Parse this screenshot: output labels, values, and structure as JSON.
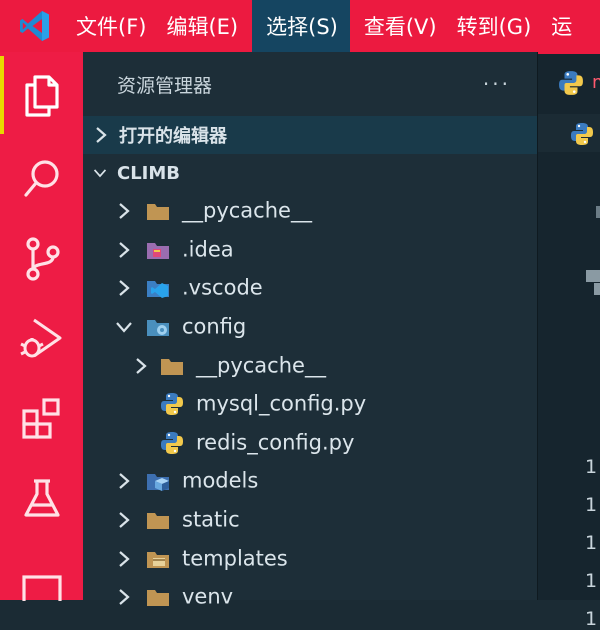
{
  "menu": {
    "items": [
      "文件(F)",
      "编辑(E)",
      "选择(S)",
      "查看(V)",
      "转到(G)",
      "运"
    ],
    "active_index": 2
  },
  "activity_bar": {
    "items": [
      "explorer-icon",
      "search-icon",
      "source-control-icon",
      "run-debug-icon",
      "extensions-icon",
      "testing-icon",
      "remote-icon"
    ],
    "active": "explorer-icon"
  },
  "explorer": {
    "title": "资源管理器",
    "more": "···",
    "open_editors_label": "打开的编辑器",
    "project_label": "CLIMB",
    "tree": [
      {
        "label": "__pycache__",
        "icon": "folder-icon",
        "expanded": false
      },
      {
        "label": ".idea",
        "icon": "idea-folder-icon",
        "expanded": false
      },
      {
        "label": ".vscode",
        "icon": "vscode-folder-icon",
        "expanded": false
      },
      {
        "label": "config",
        "icon": "config-folder-icon",
        "expanded": true
      },
      {
        "label": "__pycache__",
        "icon": "folder-icon",
        "expanded": false
      },
      {
        "label": "mysql_config.py",
        "icon": "python-file-icon"
      },
      {
        "label": "redis_config.py",
        "icon": "python-file-icon"
      },
      {
        "label": "models",
        "icon": "models-folder-icon",
        "expanded": false
      },
      {
        "label": "static",
        "icon": "folder-icon",
        "expanded": false
      },
      {
        "label": "templates",
        "icon": "templates-folder-icon",
        "expanded": false
      },
      {
        "label": "venv",
        "icon": "folder-icon",
        "expanded": false
      }
    ]
  },
  "editor": {
    "tab_text": "m",
    "line_numbers": [
      "1",
      "1",
      "1",
      "1",
      "1"
    ]
  },
  "colors": {
    "titlebar": "#ec1a40",
    "menu_active": "#154561",
    "activity_bar": "#ee1c45",
    "sidebar": "#1d2e38"
  }
}
